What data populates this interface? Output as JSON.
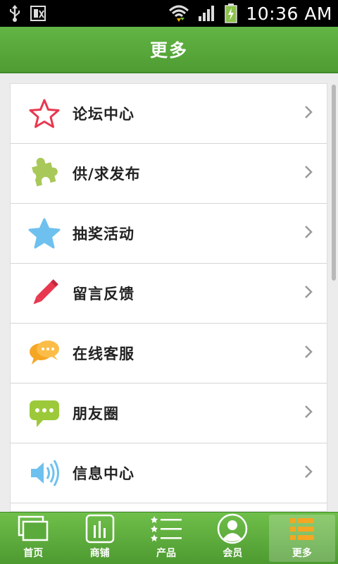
{
  "status_bar": {
    "time": "10:36 AM",
    "icons": [
      "usb-icon",
      "sim-card-icon",
      "wifi-icon",
      "signal-icon",
      "battery-charging-icon"
    ]
  },
  "header": {
    "title": "更多"
  },
  "menu": {
    "items": [
      {
        "label": "论坛中心",
        "icon": "star-outline-icon",
        "color": "#e8384f"
      },
      {
        "label": "供/求发布",
        "icon": "puzzle-icon",
        "color": "#a9c85a"
      },
      {
        "label": "抽奖活动",
        "icon": "star-filled-icon",
        "color": "#6ec1ef"
      },
      {
        "label": "留言反馈",
        "icon": "pencil-icon",
        "color": "#e8384f"
      },
      {
        "label": "在线客服",
        "icon": "chat-bubbles-icon",
        "color": "#f5a623"
      },
      {
        "label": "朋友圈",
        "icon": "speech-bubble-icon",
        "color": "#9cc93a"
      },
      {
        "label": "信息中心",
        "icon": "speaker-icon",
        "color": "#6ec1ef"
      }
    ]
  },
  "bottom_nav": {
    "tabs": [
      {
        "label": "首页",
        "icon": "home-pages-icon",
        "active": false
      },
      {
        "label": "商铺",
        "icon": "shop-bars-icon",
        "active": false
      },
      {
        "label": "产品",
        "icon": "product-list-icon",
        "active": false
      },
      {
        "label": "会员",
        "icon": "member-avatar-icon",
        "active": false
      },
      {
        "label": "更多",
        "icon": "more-list-icon",
        "active": true
      }
    ]
  },
  "colors": {
    "brand_green": "#5aab3c",
    "background": "#ececec",
    "status_bar": "#000000"
  }
}
